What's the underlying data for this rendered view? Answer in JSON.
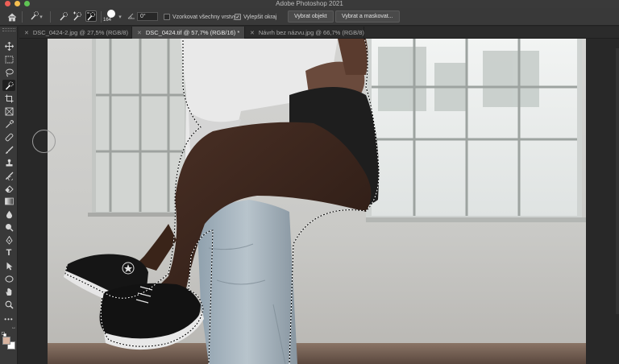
{
  "window": {
    "title": "Adobe Photoshop 2021"
  },
  "options_bar": {
    "brush_size": "164",
    "angle": "0°",
    "sample_all_layers_label": "Vzorkovat všechny vrstvy",
    "sample_all_layers_checked": false,
    "enhance_edge_label": "Vylepšit okraj",
    "enhance_edge_checked": true,
    "select_subject_label": "Vybrat objekt",
    "select_and_mask_label": "Vybrat a maskovat..."
  },
  "tabs": [
    {
      "label": "DSC_0424-2.jpg @ 27,5% (RGB/8)",
      "active": false
    },
    {
      "label": "DSC_0424.tif @ 57,7% (RGB/16) *",
      "active": true
    },
    {
      "label": "Návrh bez názvu.jpg @ 66,7% (RGB/8)",
      "active": false
    }
  ],
  "tools": [
    "move-icon",
    "marquee-icon",
    "lasso-icon",
    "quick-selection-icon",
    "crop-icon",
    "frame-icon",
    "eyedropper-icon",
    "healing-brush-icon",
    "brush-icon",
    "clone-stamp-icon",
    "history-brush-icon",
    "eraser-icon",
    "gradient-icon",
    "blur-icon",
    "dodge-icon",
    "pen-icon",
    "type-icon",
    "path-selection-icon",
    "ellipse-icon",
    "hand-icon",
    "zoom-icon",
    "more-tools-icon"
  ],
  "colors": {
    "foreground": "#d9b4a0",
    "background": "#ffffff",
    "panel": "#393939",
    "workspace": "#282828"
  }
}
